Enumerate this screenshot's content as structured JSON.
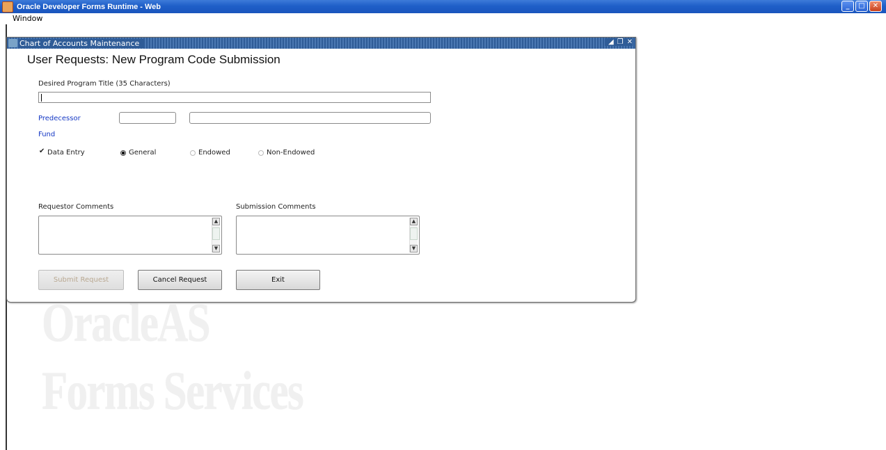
{
  "outer_window": {
    "title": "Oracle Developer Forms Runtime - Web",
    "buttons": {
      "minimize": "minimize-icon",
      "maximize": "maximize-icon",
      "close": "close-icon"
    }
  },
  "menubar": {
    "items": [
      {
        "label": "Window"
      }
    ]
  },
  "form_window": {
    "title": "Chart of Accounts Maintenance",
    "controls": {
      "minimize": "◢",
      "restore": "❐",
      "close": "✕"
    }
  },
  "form": {
    "heading": "User Requests: New Program Code Submission",
    "title_label": "Desired Program Title (35 Characters)",
    "title_value": "",
    "predecessor_label": "Predecessor",
    "predecessor_code": "",
    "predecessor_desc": "",
    "fund_label": "Fund",
    "data_entry_label": "Data Entry",
    "data_entry_checked": true,
    "fund_options": [
      {
        "label": "General",
        "selected": true
      },
      {
        "label": "Endowed",
        "selected": false
      },
      {
        "label": "Non-Endowed",
        "selected": false
      }
    ],
    "requestor_comments_label": "Requestor Comments",
    "submission_comments_label": "Submission Comments"
  },
  "buttons": {
    "submit": "Submit Request",
    "cancel": "Cancel Request",
    "exit": "Exit"
  },
  "watermark": {
    "line1": "OracleAS",
    "line2": "Forms Services"
  },
  "colors": {
    "title_blue": "#1f5fc8",
    "link_blue": "#1538c4",
    "form_title_blue": "#2f5c97"
  }
}
